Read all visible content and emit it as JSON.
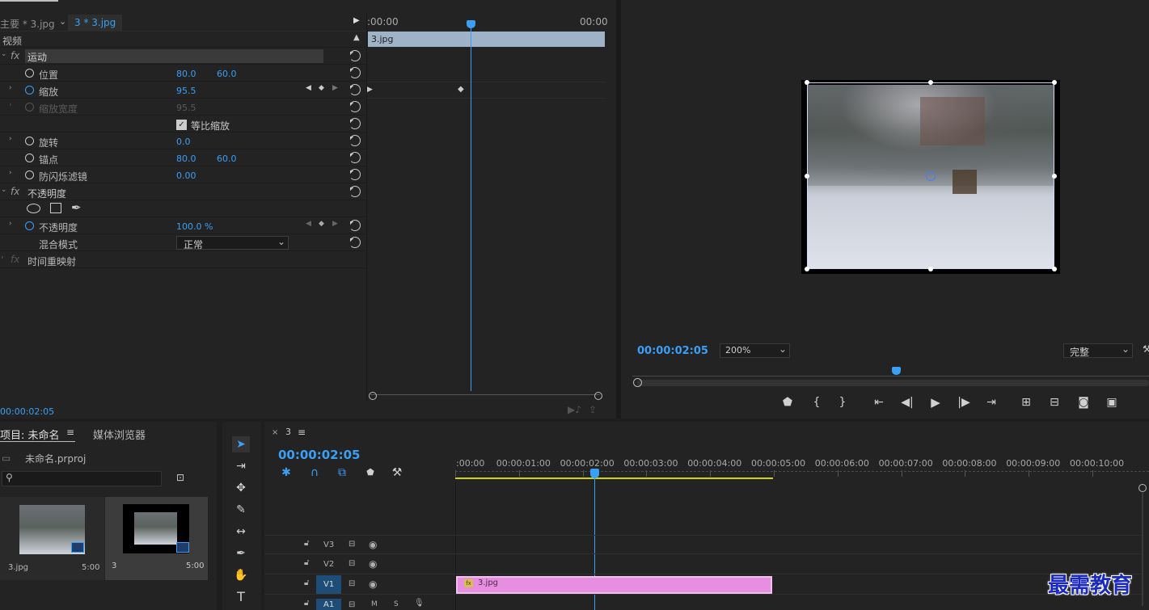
{
  "effect_controls": {
    "tab_master": "主要 * 3.jpg",
    "tab_clip": "3 * 3.jpg",
    "tl_start": ":00:00",
    "tl_end": "00:00",
    "clip_name": "3.jpg",
    "section_video": "视频",
    "motion": {
      "label": "运动",
      "position": {
        "label": "位置",
        "x": "80.0",
        "y": "60.0"
      },
      "scale": {
        "label": "缩放",
        "value": "95.5"
      },
      "scale_width": {
        "label": "缩放宽度",
        "value": "95.5"
      },
      "uniform": {
        "label": "等比缩放"
      },
      "rotation": {
        "label": "旋转",
        "value": "0.0"
      },
      "anchor": {
        "label": "锚点",
        "x": "80.0",
        "y": "60.0"
      },
      "antiflicker": {
        "label": "防闪烁滤镜",
        "value": "0.00"
      }
    },
    "opacity": {
      "label": "不透明度",
      "prop_label": "不透明度",
      "value": "100.0 %",
      "blend_label": "混合模式",
      "blend_value": "正常"
    },
    "time_remap": "时间重映射",
    "timecode": "00:00:02:05"
  },
  "program": {
    "timecode": "00:00:02:05",
    "zoom": "200%",
    "quality": "完整"
  },
  "project": {
    "tab_project": "项目: 未命名",
    "tab_media": "媒体浏览器",
    "file": "未命名.prproj",
    "items": [
      {
        "name": "3.jpg",
        "duration": "5:00"
      },
      {
        "name": "3",
        "duration": "5:00"
      }
    ]
  },
  "timeline": {
    "tab": "3",
    "timecode": "00:00:02:05",
    "ruler": [
      ":00:00",
      "00:00:01:00",
      "00:00:02:00",
      "00:00:03:00",
      "00:00:04:00",
      "00:00:05:00",
      "00:00:06:00",
      "00:00:07:00",
      "00:00:08:00",
      "00:00:09:00",
      "00:00:10:00"
    ],
    "tracks": [
      "V3",
      "V2",
      "V1",
      "A1"
    ],
    "track_m": "M",
    "track_s": "S",
    "clip": {
      "name": "3.jpg",
      "color": "#e88ee0"
    }
  },
  "watermark": "最需教育",
  "colors": {
    "accent": "#3a9ff5",
    "clip": "#e88ee0",
    "workarea": "#d4d400"
  }
}
